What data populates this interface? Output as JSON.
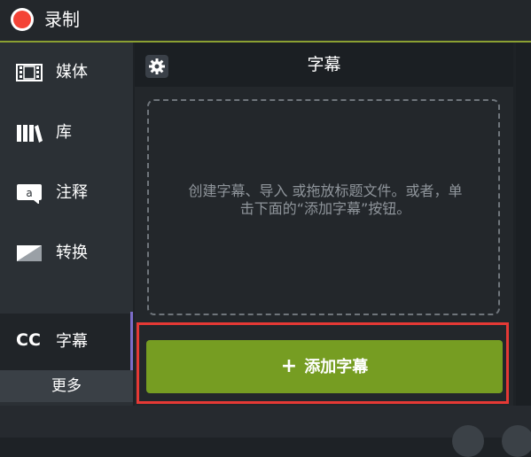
{
  "topbar": {
    "title": "录制",
    "record_color": "#f44336",
    "accent": "#8ba032"
  },
  "sidebar": {
    "items": [
      {
        "label": "媒体",
        "icon": "film-icon"
      },
      {
        "label": "库",
        "icon": "library-icon"
      },
      {
        "label": "注释",
        "icon": "annotation-icon"
      },
      {
        "label": "转换",
        "icon": "transition-icon"
      },
      {
        "label": "字幕",
        "icon": "cc-icon",
        "icon_text": "CC",
        "active": true
      }
    ],
    "more_label": "更多"
  },
  "panel": {
    "title": "字幕",
    "dropzone_text": "创建字幕、导入 或拖放标题文件。或者，单击下面的“添加字幕”按钮。",
    "add_button": {
      "icon": "+",
      "label": "添加字幕",
      "color": "#769d22"
    }
  }
}
